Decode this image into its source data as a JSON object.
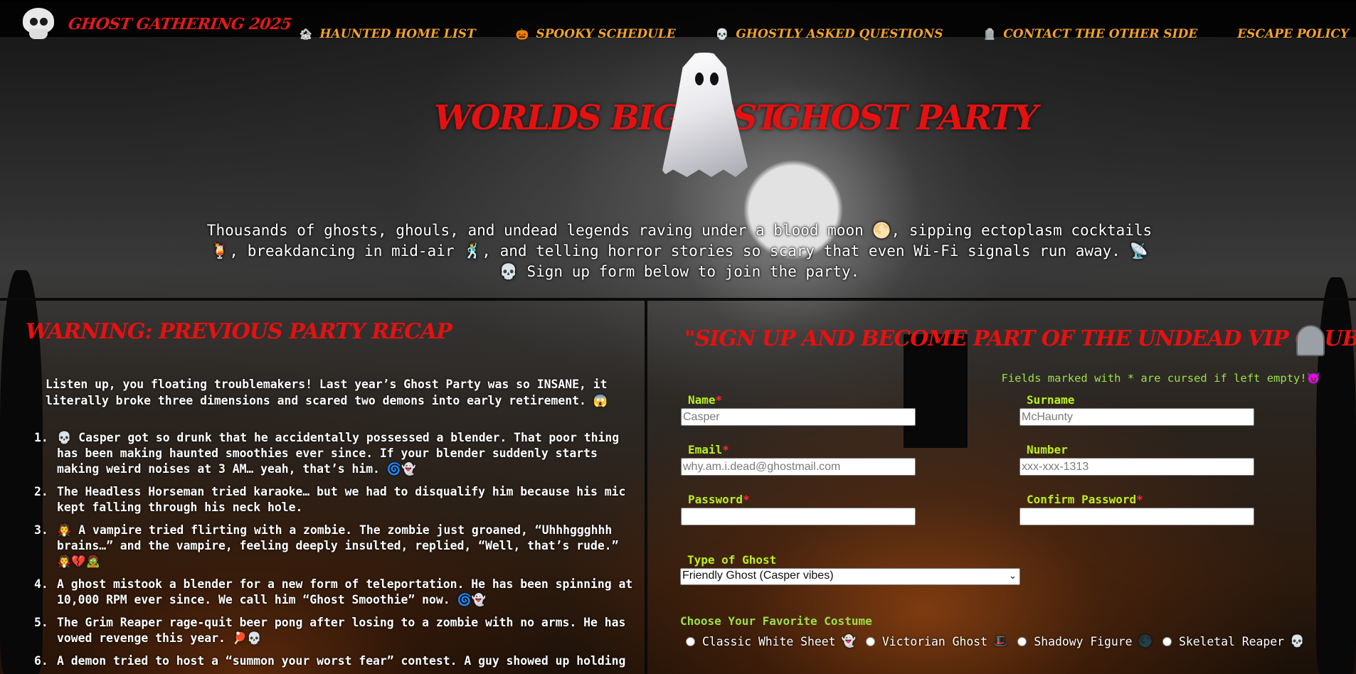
{
  "brand": {
    "name": "GHOST GATHERING  2025"
  },
  "nav": [
    {
      "icon": "🏚",
      "label": "HAUNTED HOME LIST"
    },
    {
      "icon": "🎃",
      "label": "SPOOKY SCHEDULE"
    },
    {
      "icon": "💀",
      "label": "GHOSTLY ASKED QUESTIONS"
    },
    {
      "icon": "🪦",
      "label": "CONTACT THE OTHER SIDE"
    },
    {
      "icon": "",
      "label": "ESCAPE POLICY"
    }
  ],
  "hero": {
    "title_left": "WORLDS BIGGEST",
    "title_right": "GHOST PARTY",
    "text": "Thousands of ghosts, ghouls, and undead legends raving under a blood moon 🌕, sipping ectoplasm cocktails 🍹, breakdancing in mid-air 🕺, and telling horror stories so scary that even Wi-Fi signals run away. 📡💀 Sign up form below to join the party."
  },
  "recap": {
    "title": "WARNING: PREVIOUS PARTY RECAP",
    "intro": "Listen up, you floating troublemakers! Last year’s Ghost Party was so INSANE, it literally broke three dimensions and scared two demons into early retirement. 😱",
    "items": [
      {
        "num": "1.",
        "text": "💀 Casper got so drunk that he accidentally possessed a blender. That poor thing has been making haunted smoothies ever since. If your blender suddenly starts making weird noises at 3 AM… yeah, that’s him. 🌀👻"
      },
      {
        "num": "2.",
        "text": "The Headless Horseman tried karaoke… but we had to disqualify him because his mic kept falling through his neck hole."
      },
      {
        "num": "3.",
        "text": "🧛 A vampire tried flirting with a zombie. The zombie just groaned, “Uhhhggghhh brains…” and the vampire, feeling deeply insulted, replied, “Well, that’s rude.” 🧛💔🧟"
      },
      {
        "num": "4.",
        "text": "A ghost mistook a blender for a new form of teleportation. He has been spinning at 10,000 RPM ever since. We call him “Ghost Smoothie” now. 🌀👻"
      },
      {
        "num": "5.",
        "text": "The Grim Reaper rage-quit beer pong after losing to a zombie with no arms. He has vowed revenge this year. 🏓💀"
      },
      {
        "num": "6.",
        "text": "A demon tried to host a “summon your worst fear” contest. A guy showed up holding"
      }
    ]
  },
  "signup": {
    "title": "\"SIGN UP AND BECOME PART OF THE UNDEAD VIP CLUB!\"",
    "required_note": "Fields marked with * are cursed if left empty!😈",
    "fields": {
      "name": {
        "label": "Name",
        "required": "*",
        "placeholder": "Casper"
      },
      "surname": {
        "label": "Surname",
        "placeholder": "McHaunty"
      },
      "email": {
        "label": "Email",
        "required": "*",
        "placeholder": "why.am.i.dead@ghostmail.com"
      },
      "number": {
        "label": "Number",
        "placeholder": "xxx-xxx-1313"
      },
      "password": {
        "label": "Password",
        "required": "*",
        "placeholder": ""
      },
      "confirm": {
        "label": "Confirm Password",
        "required": "*",
        "placeholder": ""
      }
    },
    "ghost_type": {
      "label": "Type of Ghost",
      "selected": "Friendly Ghost (Casper vibes)"
    },
    "costume": {
      "label": "Choose Your Favorite Costume",
      "options": [
        {
          "label": "Classic White Sheet",
          "emoji": "👻"
        },
        {
          "label": "Victorian Ghost",
          "emoji": "🎩"
        },
        {
          "label": "Shadowy Figure",
          "emoji": "🌑"
        },
        {
          "label": "Skeletal Reaper",
          "emoji": "💀"
        }
      ]
    }
  },
  "colors": {
    "accent_red": "#e51111",
    "nav_orange": "#f2a22a",
    "label_green": "#b9f020"
  }
}
